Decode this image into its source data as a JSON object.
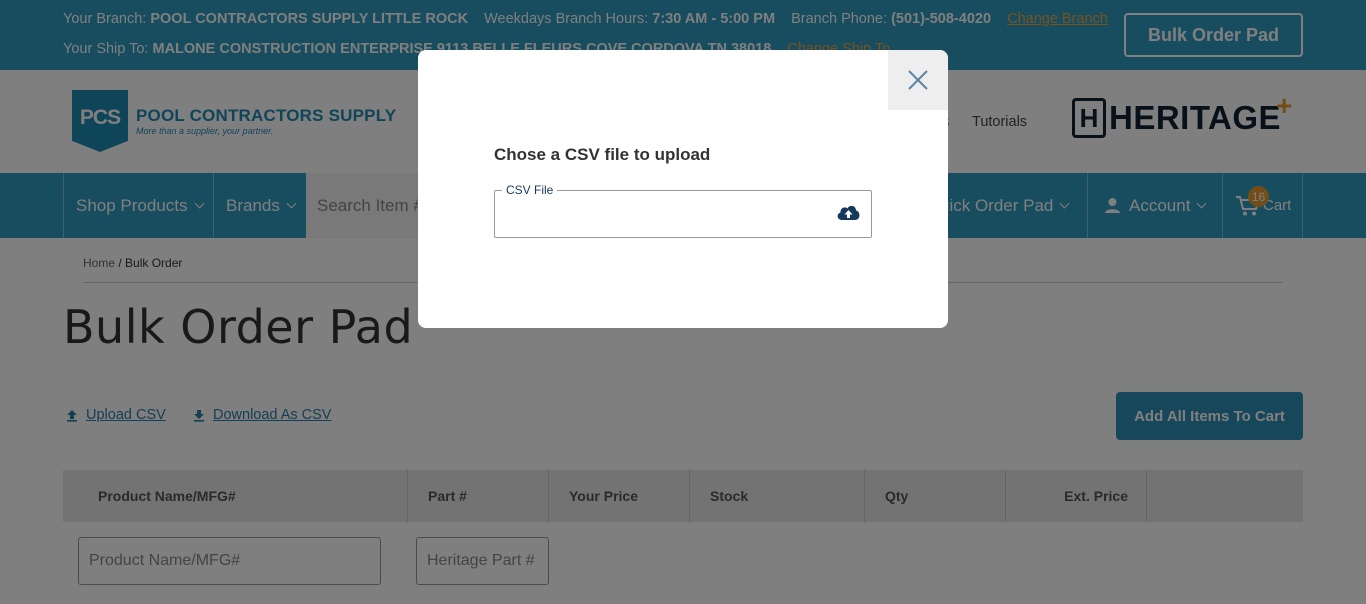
{
  "topbar": {
    "branch_label": "Your Branch:",
    "branch_value": "POOL CONTRACTORS SUPPLY LITTLE ROCK",
    "hours_label": "Weekdays Branch Hours:",
    "hours_value": "7:30 AM - 5:00 PM",
    "phone_label": "Branch Phone:",
    "phone_value": "(501)-508-4020",
    "change_branch": "Change Branch",
    "shipto_label": "Your Ship To:",
    "shipto_value": "MALONE CONSTRUCTION ENTERPRISE,9113 BELLE FLEURS COVE CORDOVA TN 38018",
    "change_shipto": "Change Ship To",
    "bulk_order_pad": "Bulk Order Pad"
  },
  "logo": {
    "badge": "PCS",
    "name": "POOL CONTRACTORS SUPPLY",
    "tagline": "More than a supplier, your partner."
  },
  "nav_links": {
    "partial": "s",
    "tutorials": "Tutorials"
  },
  "heritage": {
    "letter": "H",
    "word": "HERITAGE",
    "plus": "+"
  },
  "navbar": {
    "shop_products": "Shop Products",
    "brands": "Brands",
    "search_placeholder": "Search Item #",
    "quick_order_pad": "uick Order Pad",
    "account": "Account",
    "cart": "Cart",
    "cart_count": "16"
  },
  "breadcrumb": {
    "home": "Home",
    "sep": " / ",
    "current": "Bulk Order"
  },
  "page": {
    "title": "Bulk Order Pad",
    "upload_csv": "Upload CSV",
    "download_csv": "Download As CSV",
    "add_all": "Add All Items To Cart"
  },
  "table": {
    "headers": [
      "Product Name/MFG#",
      "Part #",
      "Your Price",
      "Stock",
      "Qty",
      "Ext. Price"
    ],
    "product_placeholder": "Product Name/MFG#",
    "part_placeholder": "Heritage Part #"
  },
  "modal": {
    "title": "Chose a CSV file to upload",
    "field_label": "CSV File"
  },
  "colors": {
    "brand_blue": "#2f9bbf",
    "accent_orange": "#f0a63c",
    "dark_navy": "#173a5c"
  }
}
